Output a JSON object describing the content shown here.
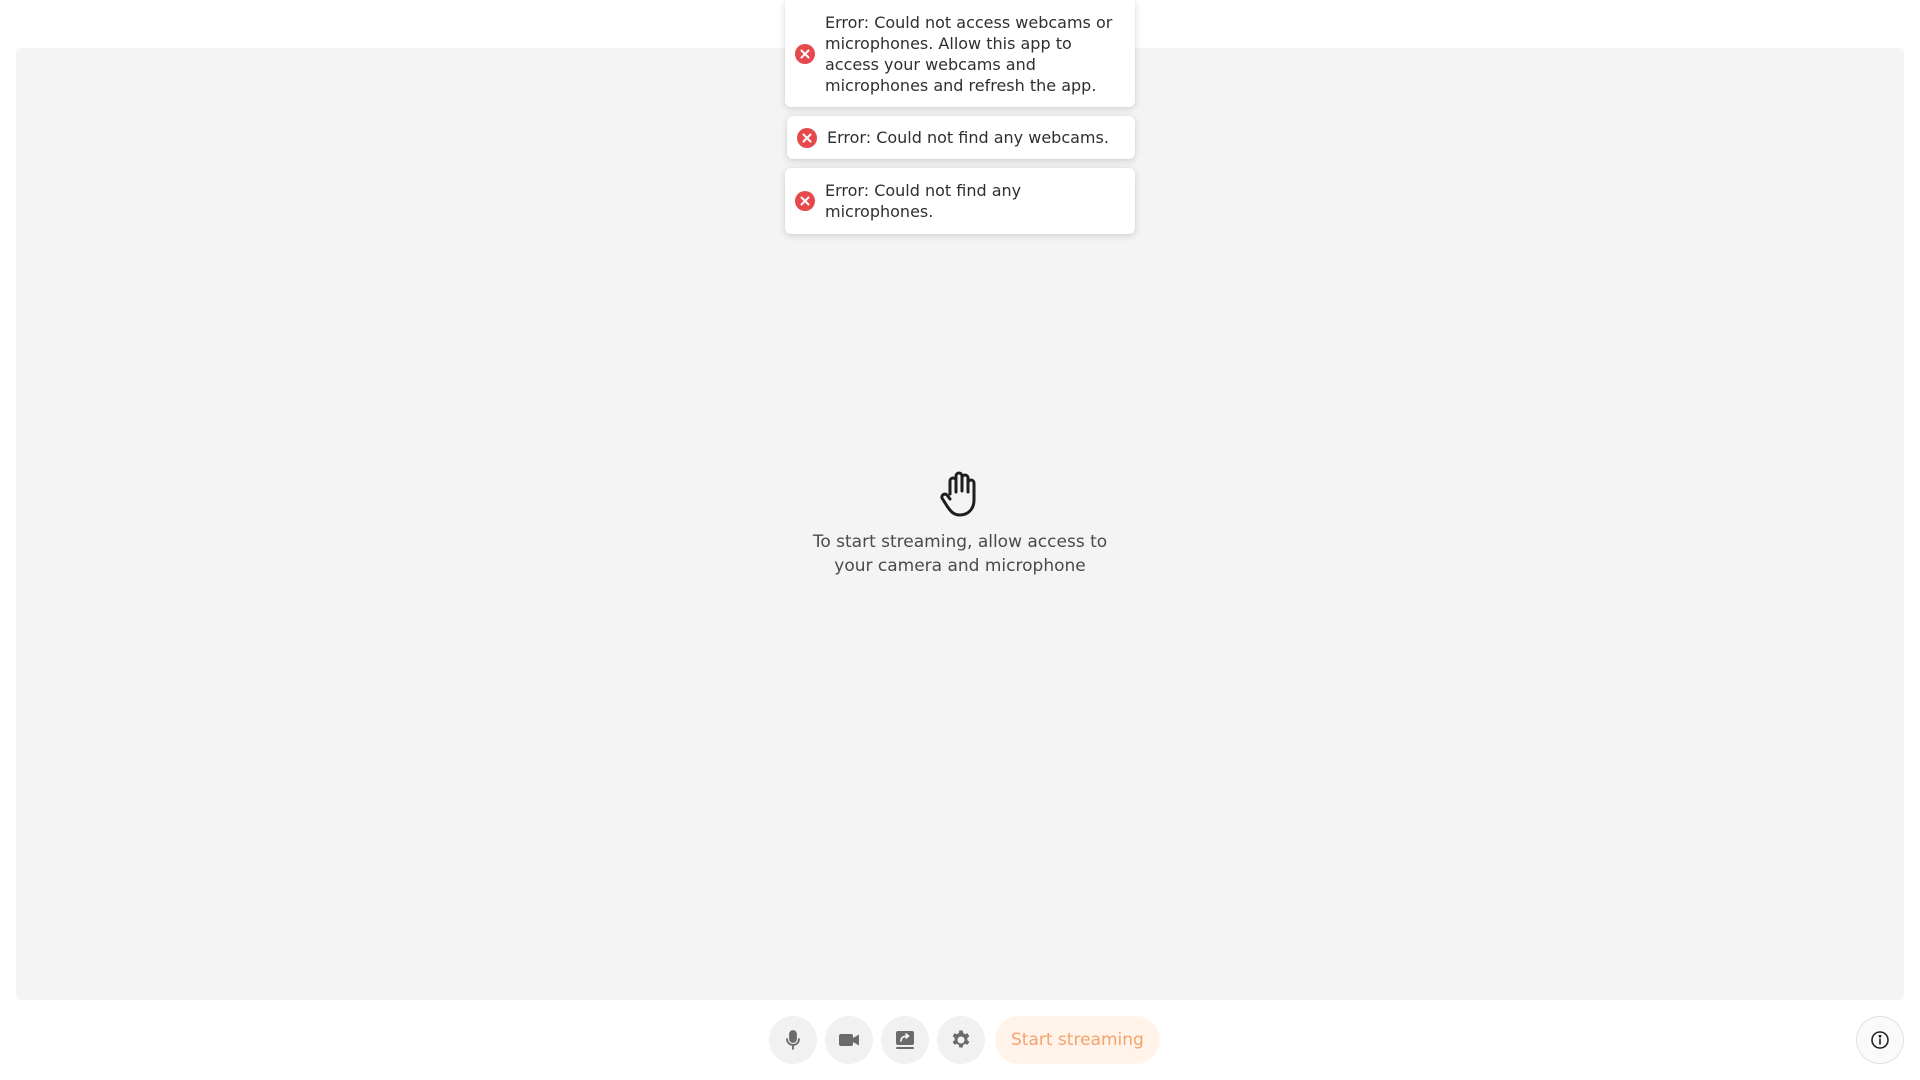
{
  "colors": {
    "stage_background": "#f4f4f4",
    "error_red": "#e5484d",
    "start_button_bg": "#fff3ea",
    "start_button_text": "#f4a36d",
    "control_icon": "#6b6b6b"
  },
  "toasts": [
    {
      "icon": "error-icon",
      "message": "Error: Could not access webcams or microphones. Allow this app to access your webcams and microphones and refresh the app."
    },
    {
      "icon": "error-icon",
      "message": "Error: Could not find any webcams."
    },
    {
      "icon": "error-icon",
      "message": "Error: Could not find any microphones."
    }
  ],
  "placeholder": {
    "icon": "hand-stop-icon",
    "text": "To start streaming, allow access to your camera and microphone"
  },
  "controls": {
    "microphone": {
      "icon": "microphone-icon"
    },
    "camera": {
      "icon": "video-camera-icon"
    },
    "screen_share": {
      "icon": "screen-share-icon"
    },
    "settings": {
      "icon": "gear-icon"
    },
    "start_label": "Start streaming"
  },
  "info": {
    "icon": "info-icon"
  }
}
